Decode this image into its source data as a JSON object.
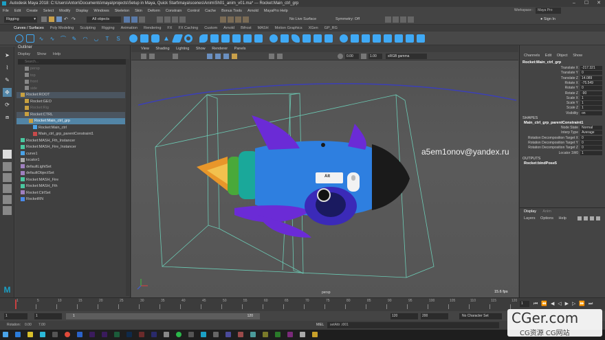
{
  "window": {
    "title": "Autodesk Maya 2018: C:\\Users\\Anton\\Documents\\maya\\projects\\Setup in Maya, Quick Start\\maya\\scenes\\Anim\\Sh01_anim_v01.ma*   ---   Rocket:Main_ctrl_grp",
    "minimize": "–",
    "maximize": "☐",
    "close": "✕"
  },
  "menubar": [
    "File",
    "Edit",
    "Create",
    "Select",
    "Modify",
    "Display",
    "Windows",
    "Skeleton",
    "Skin",
    "Deform",
    "Constrain",
    "Control",
    "Cache",
    "Bonus Tools",
    "Arnold",
    "MayaPro Help"
  ],
  "statusline": {
    "mode": "Rigging",
    "objects": "All objects",
    "live_surface": "No Live Surface",
    "symmetry": "Symmetry: Off",
    "signin": "Sign In",
    "workspace_label": "Workspace :",
    "workspace_value": "Maya Pro"
  },
  "shelf_tabs": [
    "Curves / Surfaces",
    "Poly Modeling",
    "Sculpting",
    "Rigging",
    "Animation",
    "Rendering",
    "FX",
    "FX Caching",
    "Custom",
    "Arnold",
    "Bifrost",
    "MASH",
    "Motion Graphics",
    "XGen",
    "GP_RG"
  ],
  "shelf_active": "Curves / Surfaces",
  "outliner": {
    "title": "Outliner",
    "menu": [
      "Display",
      "Show",
      "Help"
    ],
    "search_placeholder": "Search...",
    "rows": [
      {
        "label": "persp",
        "state": "dim",
        "indent": 2,
        "icon": "camera-icon"
      },
      {
        "label": "top",
        "state": "dim",
        "indent": 2,
        "icon": "camera-icon"
      },
      {
        "label": "front",
        "state": "dim",
        "indent": 2,
        "icon": "camera-icon"
      },
      {
        "label": "side",
        "state": "dim",
        "indent": 2,
        "icon": "camera-icon"
      },
      {
        "label": "Rocket:ROOT",
        "state": "hl",
        "indent": 1,
        "icon": "group-icon"
      },
      {
        "label": "Rocket:GEO",
        "state": "normal",
        "indent": 2,
        "icon": "group-icon"
      },
      {
        "label": "Rocket:Rig",
        "state": "dim",
        "indent": 2,
        "icon": "group-icon"
      },
      {
        "label": "Rocket:CTRL",
        "state": "hl",
        "indent": 2,
        "icon": "group-icon"
      },
      {
        "label": "Rocket:Main_ctrl_grp",
        "state": "sel",
        "indent": 3,
        "icon": "group-icon"
      },
      {
        "label": "Rocket:Main_ctrl",
        "state": "normal",
        "indent": 4,
        "icon": "curve-icon"
      },
      {
        "label": "Main_ctrl_grp_parentConstraint1",
        "state": "normal",
        "indent": 4,
        "icon": "constraint-icon"
      },
      {
        "label": "Rocket:MASH_Fth_Instancer",
        "state": "normal",
        "indent": 1,
        "icon": "mash-icon"
      },
      {
        "label": "Rocket:MASH_Fire_Instancer",
        "state": "normal",
        "indent": 1,
        "icon": "mash-icon"
      },
      {
        "label": "curve1",
        "state": "normal",
        "indent": 1,
        "icon": "curve-icon"
      },
      {
        "label": "locator1",
        "state": "normal",
        "indent": 1,
        "icon": "locator-icon"
      },
      {
        "label": "defaultLightSet",
        "state": "normal",
        "indent": 1,
        "icon": "set-icon"
      },
      {
        "label": "defaultObjectSet",
        "state": "normal",
        "indent": 1,
        "icon": "set-icon"
      },
      {
        "label": "Rocket:MASH_Fire",
        "state": "normal",
        "indent": 1,
        "icon": "mash-icon"
      },
      {
        "label": "Rocket:MASH_Fth",
        "state": "normal",
        "indent": 1,
        "icon": "mash-icon"
      },
      {
        "label": "Rocket:CtrlSet",
        "state": "normal",
        "indent": 1,
        "icon": "set-icon"
      },
      {
        "label": "RocketRN",
        "state": "normal",
        "indent": 1,
        "icon": "reference-icon"
      }
    ]
  },
  "viewport": {
    "menu": [
      "View",
      "Shading",
      "Lighting",
      "Show",
      "Renderer",
      "Panels"
    ],
    "exposure": "0.00",
    "gamma": "1.00",
    "colorspace": "sRGB gamma",
    "camera_label": "persp",
    "fps": "15.6 fps",
    "overlay_text": "a5em1onov@yandex.ru",
    "key_alt": "Alt"
  },
  "channel_box": {
    "tabs": [
      "Channels",
      "Edit",
      "Object",
      "Show"
    ],
    "node": "Rocket:Main_ctrl_grp",
    "attrs": [
      {
        "name": "Translate X",
        "value": "-217.321"
      },
      {
        "name": "Translate Y",
        "value": "0"
      },
      {
        "name": "Translate Z",
        "value": "14.089"
      },
      {
        "name": "Rotate X",
        "value": "-75.549"
      },
      {
        "name": "Rotate Y",
        "value": "0"
      },
      {
        "name": "Rotate Z",
        "value": "-90"
      },
      {
        "name": "Scale X",
        "value": "1"
      },
      {
        "name": "Scale Y",
        "value": "1"
      },
      {
        "name": "Scale Z",
        "value": "1"
      },
      {
        "name": "Visibility",
        "value": "on"
      }
    ],
    "shapes_header": "SHAPES",
    "constraint_node": "Main_ctrl_grp_parentConstraint1",
    "constraint_attrs": [
      {
        "name": "Node State",
        "value": "Normal"
      },
      {
        "name": "Interp Type",
        "value": "Average"
      },
      {
        "name": "Rotation Decomposition Target X",
        "value": "0"
      },
      {
        "name": "Rotation Decomposition Target Y",
        "value": "0"
      },
      {
        "name": "Rotation Decomposition Target Z",
        "value": "0"
      },
      {
        "name": "Locator 1W0",
        "value": "1"
      }
    ],
    "outputs_header": "OUTPUTS",
    "output_node": "Rocket:bindPose5"
  },
  "layer_editor": {
    "tabs": [
      "Display",
      "Anim"
    ],
    "menu": [
      "Layers",
      "Options",
      "Help"
    ]
  },
  "timeline": {
    "ticks": [
      "1",
      "5",
      "10",
      "15",
      "20",
      "25",
      "30",
      "35",
      "40",
      "45",
      "50",
      "55",
      "60",
      "65",
      "70",
      "75",
      "80",
      "85",
      "90",
      "95",
      "100",
      "105",
      "110",
      "115",
      "120"
    ],
    "current": "1"
  },
  "range": {
    "start": "1",
    "inner_start": "1",
    "inner_end": "120",
    "end": "120",
    "anim_end": "200",
    "character": "No Character Set",
    "current_frame": "1"
  },
  "command_line": {
    "lang": "MEL",
    "text": "setAttr .t001",
    "rotation_label": "Rotation:",
    "rotation_x": "0.00",
    "rotation_y": "7.00"
  },
  "watermark": {
    "big": "CGer.com",
    "small": "CG资源  CG网站"
  },
  "colors": {
    "selection": "#5285a6",
    "rocket_blue": "#2e7fe0",
    "rocket_purple": "#6b2bd6",
    "rocket_teal": "#1aa89a",
    "rocket_green": "#49a93a",
    "flame": "#e8962a",
    "cage": "#6fd9c0"
  }
}
